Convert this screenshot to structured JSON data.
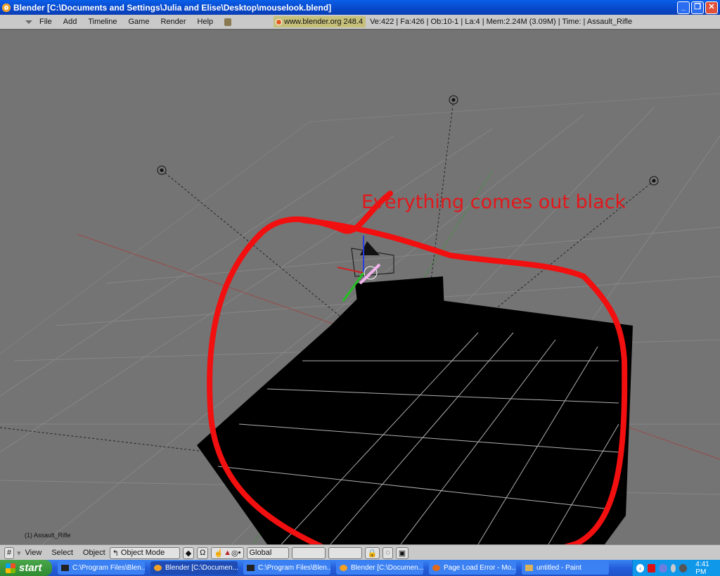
{
  "window": {
    "title": "Blender [C:\\Documents and Settings\\Julia and Elise\\Desktop\\mouselook.blend]",
    "controls": [
      "minimize",
      "restore",
      "close"
    ]
  },
  "menubar": {
    "items": [
      "File",
      "Add",
      "Timeline",
      "Game",
      "Render",
      "Help"
    ],
    "site": "www.blender.org 248.4",
    "stats": "Ve:422 | Fa:426 | Ob:10-1 | La:4  | Mem:2.24M (3.09M)  | Time: | Assault_Rifle"
  },
  "viewport": {
    "annotation": "Everything comes out black",
    "annotation_color": "#e3171b",
    "object_label": "(1) Assault_Rifle",
    "background_color": "#747474"
  },
  "header3d": {
    "menus": [
      "View",
      "Select",
      "Object"
    ],
    "mode": "Object Mode",
    "orientation": "Global"
  },
  "taskbar": {
    "start_label": "start",
    "tasks": [
      {
        "label": "C:\\Program Files\\Blen...",
        "icon": "console-icon",
        "active": false
      },
      {
        "label": "Blender [C:\\Documen...",
        "icon": "blender-icon",
        "active": true
      },
      {
        "label": "C:\\Program Files\\Blen...",
        "icon": "console-icon",
        "active": false
      },
      {
        "label": "Blender [C:\\Documen...",
        "icon": "blender-icon",
        "active": false
      },
      {
        "label": "Page Load Error - Mo...",
        "icon": "firefox-icon",
        "active": false
      },
      {
        "label": "untitled - Paint",
        "icon": "paint-icon",
        "active": false
      }
    ],
    "clock": "4:41 PM"
  }
}
